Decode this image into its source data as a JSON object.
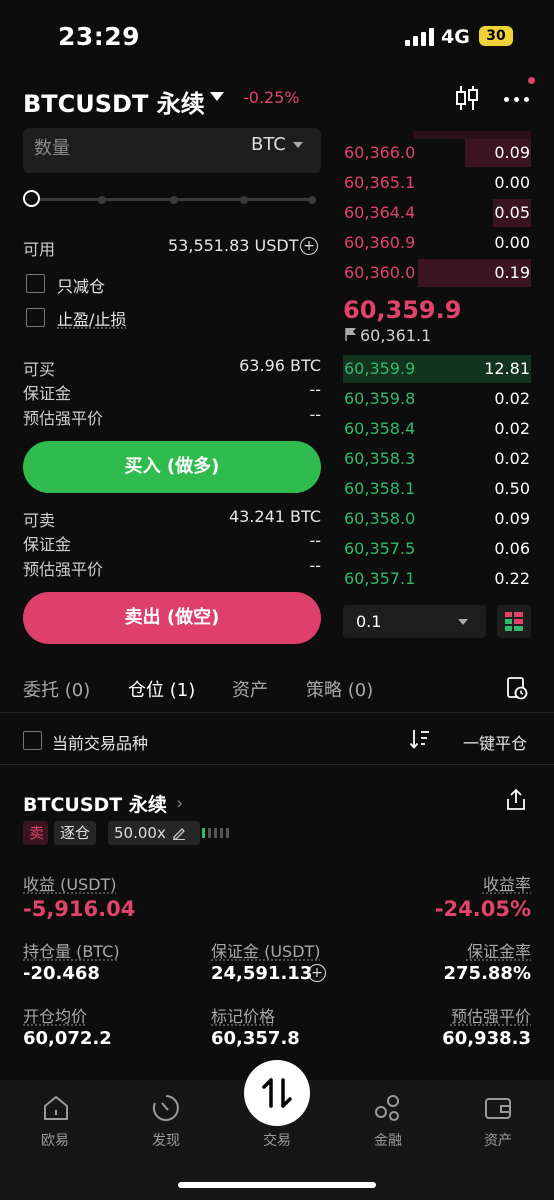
{
  "status_bar": {
    "time": "23:29",
    "network": "4G",
    "battery": "30"
  },
  "header": {
    "pair": "BTCUSDT 永续",
    "change": "-0.25%"
  },
  "order_form": {
    "qty_placeholder": "数量",
    "qty_unit": "BTC",
    "available_label": "可用",
    "available_value": "53,551.83 USDT",
    "reduce_only": "只减仓",
    "tp_sl": "止盈/止损",
    "buy_max_label": "可买",
    "buy_max_value": "63.96 BTC",
    "buy_margin_label": "保证金",
    "buy_margin_value": "--",
    "buy_liq_label": "预估强平价",
    "buy_liq_value": "--",
    "buy_button": "买入 (做多)",
    "sell_max_label": "可卖",
    "sell_max_value": "43.241 BTC",
    "sell_margin_label": "保证金",
    "sell_margin_value": "--",
    "sell_liq_label": "预估强平价",
    "sell_liq_value": "--",
    "sell_button": "卖出 (做空)"
  },
  "order_book": {
    "asks": [
      {
        "price": "60,366.0",
        "qty": "0.09",
        "depth": 0.35
      },
      {
        "price": "60,365.1",
        "qty": "0.00",
        "depth": 0.0
      },
      {
        "price": "60,364.4",
        "qty": "0.05",
        "depth": 0.2
      },
      {
        "price": "60,360.9",
        "qty": "0.00",
        "depth": 0.0
      },
      {
        "price": "60,360.0",
        "qty": "0.19",
        "depth": 0.6
      }
    ],
    "last_price": "60,359.9",
    "mark_price": "60,361.1",
    "bids": [
      {
        "price": "60,359.9",
        "qty": "12.81",
        "depth": 1.0
      },
      {
        "price": "60,359.8",
        "qty": "0.02",
        "depth": 0.0
      },
      {
        "price": "60,358.4",
        "qty": "0.02",
        "depth": 0.0
      },
      {
        "price": "60,358.3",
        "qty": "0.02",
        "depth": 0.0
      },
      {
        "price": "60,358.1",
        "qty": "0.50",
        "depth": 0.0
      },
      {
        "price": "60,358.0",
        "qty": "0.09",
        "depth": 0.0
      },
      {
        "price": "60,357.5",
        "qty": "0.06",
        "depth": 0.0
      },
      {
        "price": "60,357.1",
        "qty": "0.22",
        "depth": 0.0
      }
    ],
    "depth_step": "0.1"
  },
  "tabs": [
    {
      "label": "委托 (0)",
      "active": false
    },
    {
      "label": "仓位 (1)",
      "active": true
    },
    {
      "label": "资产",
      "active": false
    },
    {
      "label": "策略 (0)",
      "active": false
    }
  ],
  "filter": {
    "current_symbol": "当前交易品种",
    "close_all": "一键平仓"
  },
  "position": {
    "title": "BTCUSDT 永续",
    "side_tag": "卖",
    "margin_mode": "逐仓",
    "leverage": "50.00x",
    "pnl_label": "收益 (USDT)",
    "pnl_value": "-5,916.04",
    "roe_label": "收益率",
    "roe_value": "-24.05%",
    "size_label": "持仓量 (BTC)",
    "size_value": "-20.468",
    "margin_label": "保证金 (USDT)",
    "margin_value": "24,591.13",
    "margin_ratio_label": "保证金率",
    "margin_ratio_value": "275.88%",
    "entry_label": "开仓均价",
    "entry_value": "60,072.2",
    "mark_label": "标记价格",
    "mark_value": "60,357.8",
    "liq_label": "预估强平价",
    "liq_value": "60,938.3"
  },
  "nav": [
    {
      "label": "欧易",
      "icon": "home-icon"
    },
    {
      "label": "发现",
      "icon": "discover-icon"
    },
    {
      "label": "交易",
      "icon": "trade-icon"
    },
    {
      "label": "金融",
      "icon": "finance-icon"
    },
    {
      "label": "资产",
      "icon": "wallet-icon"
    }
  ],
  "colors": {
    "accent_red": "#e0436c",
    "accent_green": "#2fbb4e"
  }
}
